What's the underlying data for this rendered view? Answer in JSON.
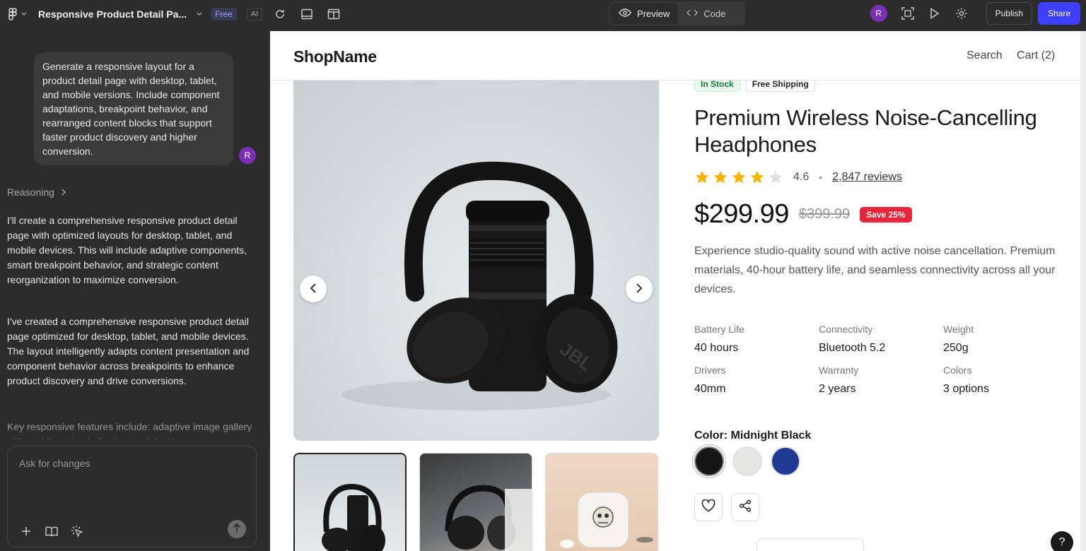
{
  "topbar": {
    "file_title": "Responsive Product Detail Pa...",
    "badge_free": "Free",
    "badge_ai": "AI",
    "preview_label": "Preview",
    "code_label": "Code",
    "avatar_initial": "R",
    "publish_label": "Publish",
    "share_label": "Share",
    "share_color": "#3f3fff"
  },
  "chat": {
    "user_message": "Generate a responsive layout for a product detail page with desktop, tablet, and mobile versions. Include component adaptations, breakpoint behavior, and rearranged content blocks that support faster product discovery and higher conversion.",
    "user_initial": "R",
    "reasoning_label": "Reasoning",
    "ai_paragraph_1": "I'll create a comprehensive responsive product detail page with optimized layouts for desktop, tablet, and mobile devices. This will include adaptive components, smart breakpoint behavior, and strategic content reorganization to maximize conversion.",
    "ai_paragraph_2": "I've created a comprehensive responsive product detail page optimized for desktop, tablet, and mobile devices. The layout intelligently adapts content presentation and component behavior across breakpoints to enhance product discovery and drive conversions.",
    "ai_paragraph_3": "Key responsive features include: adaptive image gallery with mobile swipe indicators and desktop",
    "input_placeholder": "Ask for changes"
  },
  "site": {
    "shop_name": "ShopName",
    "nav_search": "Search",
    "nav_cart": "Cart (2)"
  },
  "product": {
    "tag_stock": "In Stock",
    "tag_shipping": "Free Shipping",
    "title": "Premium Wireless Noise-Cancelling Headphones",
    "rating": "4.6",
    "rating_stars": 4,
    "reviews": "2,847 reviews",
    "price": "$299.99",
    "old_price": "$399.99",
    "save_label": "Save 25%",
    "description": "Experience studio-quality sound with active noise cancellation. Premium materials, 40-hour battery life, and seamless connectivity across all your devices.",
    "specs": [
      {
        "label": "Battery Life",
        "value": "40 hours"
      },
      {
        "label": "Connectivity",
        "value": "Bluetooth 5.2"
      },
      {
        "label": "Weight",
        "value": "250g"
      },
      {
        "label": "Drivers",
        "value": "40mm"
      },
      {
        "label": "Warranty",
        "value": "2 years"
      },
      {
        "label": "Colors",
        "value": "3 options"
      }
    ],
    "color_label": "Color: Midnight Black",
    "swatch_colors": [
      "#161616",
      "#e6e6e4",
      "#1f3a93"
    ],
    "help_label": "?"
  }
}
